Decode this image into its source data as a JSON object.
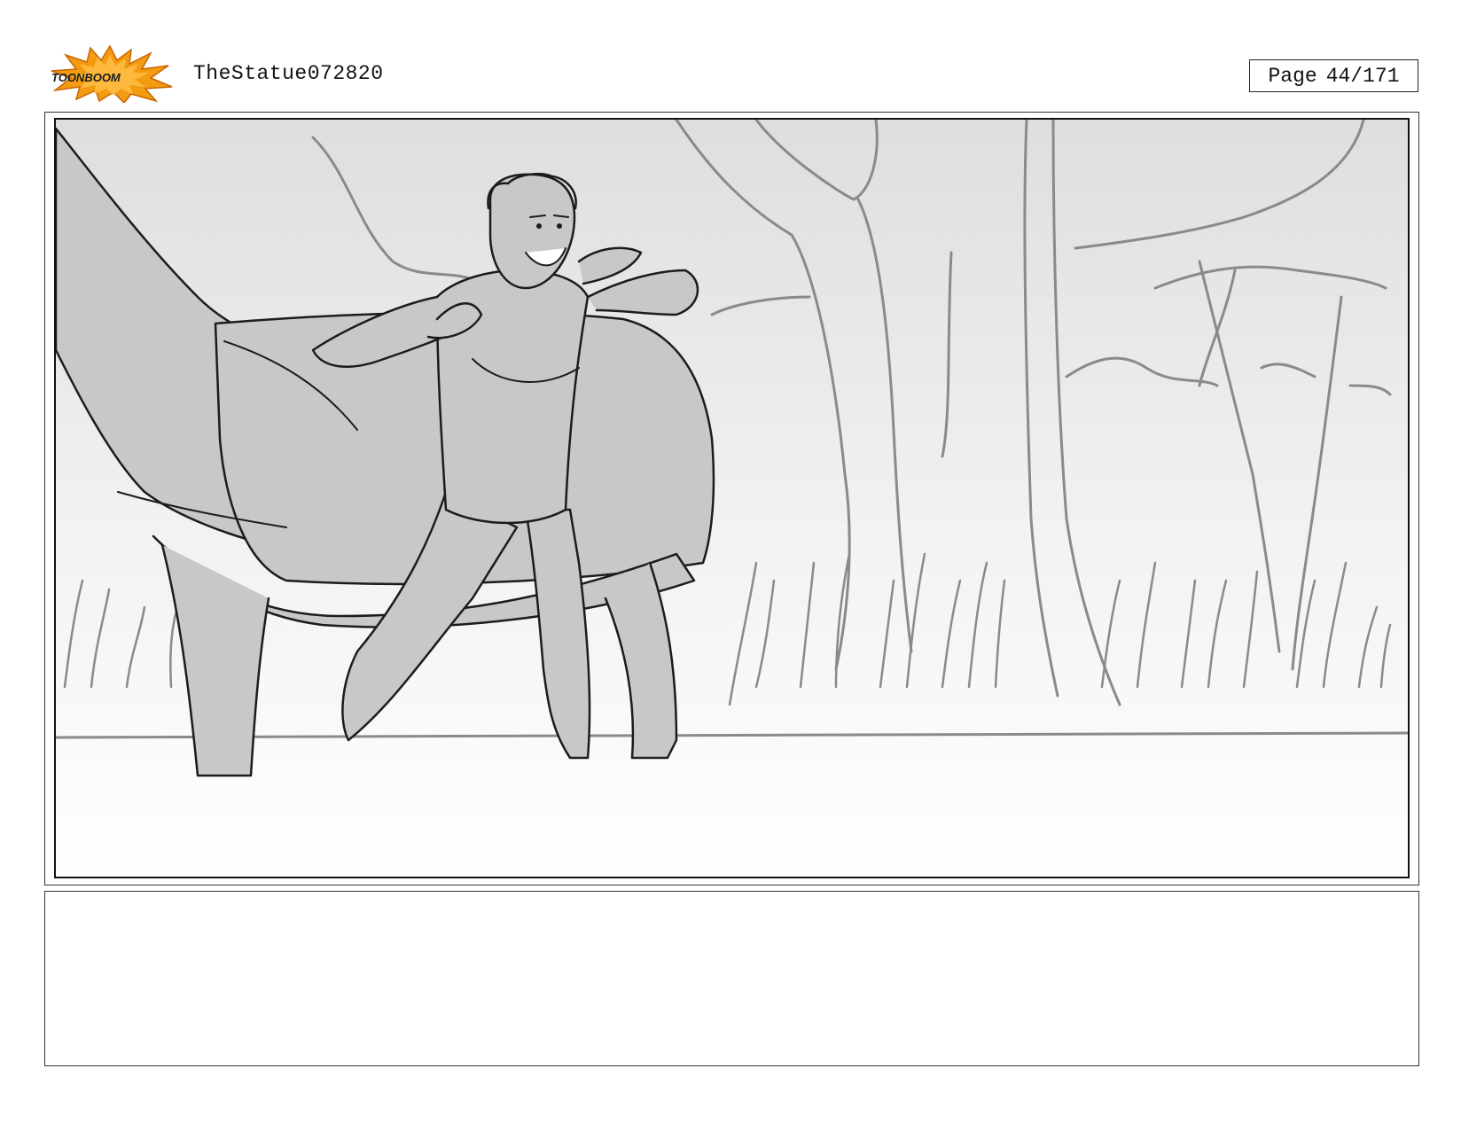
{
  "header": {
    "logo_text": "TOONBOOM",
    "document_title": "TheStatue072820",
    "page_label": "Page",
    "page_number": "44/171"
  },
  "panel": {
    "scene": "storyboard sketch"
  },
  "caption": {
    "text": ""
  },
  "colors": {
    "logo_burst": "#f39c12",
    "logo_text": "#1a1a1a",
    "sketch_fill": "#c8c8c8",
    "sketch_line": "#1c1c1c",
    "background_line": "#8a8a8a"
  }
}
